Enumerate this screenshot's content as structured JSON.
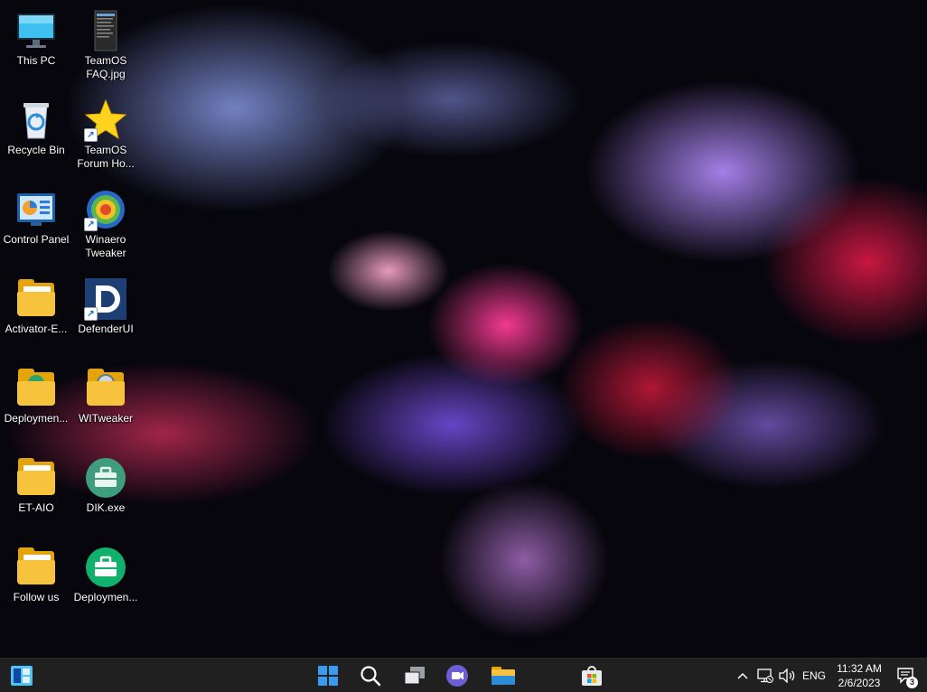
{
  "desktop_icons": [
    {
      "label": "This PC",
      "icon": "monitor-icon"
    },
    {
      "label": "TeamOS\nFAQ.jpg",
      "icon": "image-file-icon"
    },
    {
      "label": "Recycle Bin",
      "icon": "recycle-bin-icon"
    },
    {
      "label": "TeamOS\nForum Ho...",
      "icon": "star-icon",
      "shortcut": true
    },
    {
      "label": "Control Panel",
      "icon": "control-panel-icon"
    },
    {
      "label": "Winaero\nTweaker",
      "icon": "winaero-icon",
      "shortcut": true
    },
    {
      "label": "Activator-E...",
      "icon": "folder-icon"
    },
    {
      "label": "DefenderUI",
      "icon": "defenderui-icon",
      "shortcut": true
    },
    {
      "label": "Deploymen...",
      "icon": "folder-icon"
    },
    {
      "label": "WITweaker",
      "icon": "folder-icon"
    },
    {
      "label": "ET-AIO",
      "icon": "folder-icon"
    },
    {
      "label": "DIK.exe",
      "icon": "toolbox-icon"
    },
    {
      "label": "Follow us",
      "icon": "folder-icon"
    },
    {
      "label": "Deploymen...",
      "icon": "toolbox-icon"
    }
  ],
  "taskbar": {
    "widgets_icon": "widgets-icon",
    "center_items": [
      "windows-start-icon",
      "search-icon",
      "task-view-icon",
      "teams-chat-icon",
      "file-explorer-icon",
      "microsoft-store-icon"
    ],
    "tray": {
      "chevron": "^",
      "language": "ENG",
      "time": "11:32 AM",
      "date": "2/6/2023",
      "notification_count": "3"
    }
  },
  "colors": {
    "taskbar_bg": "#202020",
    "folder": "#f8c33c",
    "accent_blue": "#2b8cff"
  }
}
